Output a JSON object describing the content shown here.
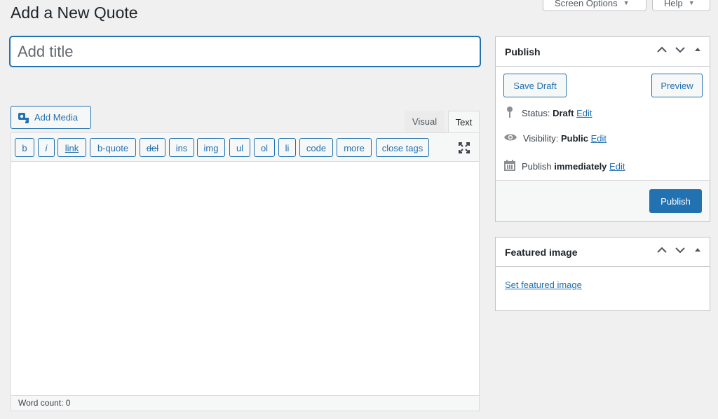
{
  "header": {
    "title": "Add a New Quote",
    "screen_options": "Screen Options",
    "help": "Help"
  },
  "title_input": {
    "placeholder": "Add title",
    "value": ""
  },
  "editor": {
    "add_media": "Add Media",
    "tabs": [
      {
        "label": "Visual"
      },
      {
        "label": "Text"
      }
    ],
    "active_tab": "Text",
    "quicktags": [
      {
        "label": "b"
      },
      {
        "label": "i"
      },
      {
        "label": "link"
      },
      {
        "label": "b-quote"
      },
      {
        "label": "del"
      },
      {
        "label": "ins"
      },
      {
        "label": "img"
      },
      {
        "label": "ul"
      },
      {
        "label": "ol"
      },
      {
        "label": "li"
      },
      {
        "label": "code"
      },
      {
        "label": "more"
      },
      {
        "label": "close tags"
      }
    ],
    "content": "",
    "word_count": "Word count: 0"
  },
  "publish_box": {
    "title": "Publish",
    "save_draft": "Save Draft",
    "preview": "Preview",
    "status_label": "Status:",
    "status_value": "Draft",
    "status_edit": "Edit",
    "visibility_label": "Visibility:",
    "visibility_value": "Public",
    "visibility_edit": "Edit",
    "publish_label": "Publish",
    "publish_value": "immediately",
    "publish_edit": "Edit",
    "publish_button": "Publish"
  },
  "featured_box": {
    "title": "Featured image",
    "link": "Set featured image"
  },
  "colors": {
    "accent": "#2271b1",
    "background": "#f0f0f1",
    "panel": "#ffffff"
  }
}
